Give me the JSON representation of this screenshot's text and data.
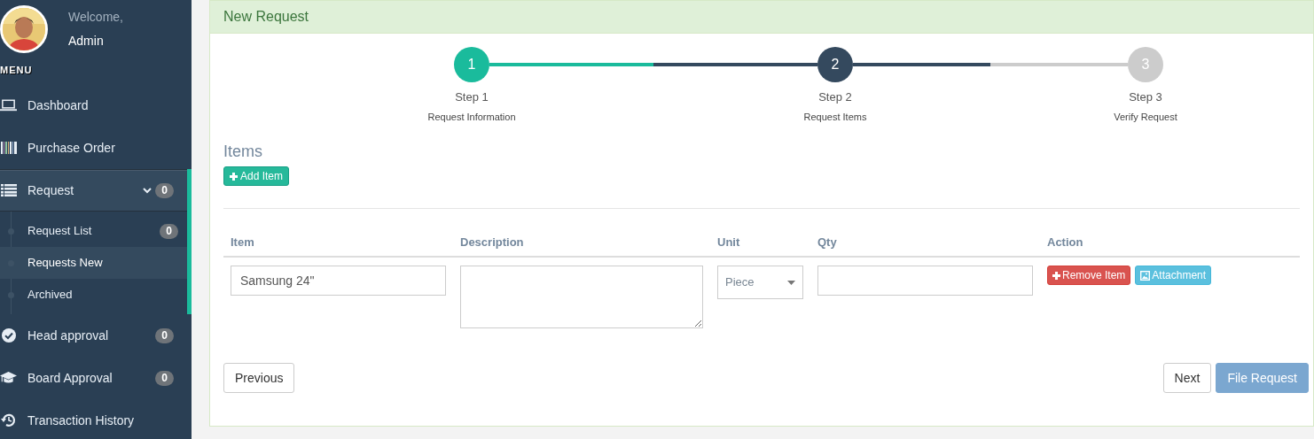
{
  "sidebar": {
    "user": {
      "greeting": "Welcome,",
      "name": "Admin"
    },
    "menu_label": "MENU",
    "items": [
      {
        "label": "Dashboard",
        "selected": false
      },
      {
        "label": "Purchase Order",
        "selected": false
      },
      {
        "label": "Request",
        "selected": true,
        "expanded": true,
        "badge": "0",
        "children": [
          {
            "label": "Request List",
            "selected": false,
            "badge": "0"
          },
          {
            "label": "Requests New",
            "selected": true
          },
          {
            "label": "Archived",
            "selected": false
          }
        ]
      },
      {
        "label": "Head approval",
        "selected": false,
        "badge": "0"
      },
      {
        "label": "Board Approval",
        "selected": false,
        "badge": "0"
      },
      {
        "label": "Transaction History",
        "selected": false
      }
    ]
  },
  "panel": {
    "title": "New Request",
    "steps": [
      {
        "number": "1",
        "title": "Step 1",
        "subtitle": "Request Information",
        "selected": false
      },
      {
        "number": "2",
        "title": "Step 2",
        "subtitle": "Request Items",
        "selected": true
      },
      {
        "number": "3",
        "title": "Step 3",
        "subtitle": "Verify Request",
        "selected": false
      }
    ],
    "items_title": "Items",
    "add_button": "Add Item",
    "table": {
      "columns": [
        "Item",
        "Description",
        "Unit",
        "Qty",
        "Action"
      ],
      "rows": [
        {
          "item": "Samsung 24\"",
          "unit": "Piece",
          "actions": [
            {
              "kind": "remove",
              "label": "Remove Item"
            },
            {
              "kind": "attach",
              "label": "Attachment"
            }
          ]
        }
      ]
    },
    "footer": {
      "previous": "Previous",
      "next": "Next",
      "submit": {
        "label": "File Request",
        "disabled": true
      }
    }
  }
}
